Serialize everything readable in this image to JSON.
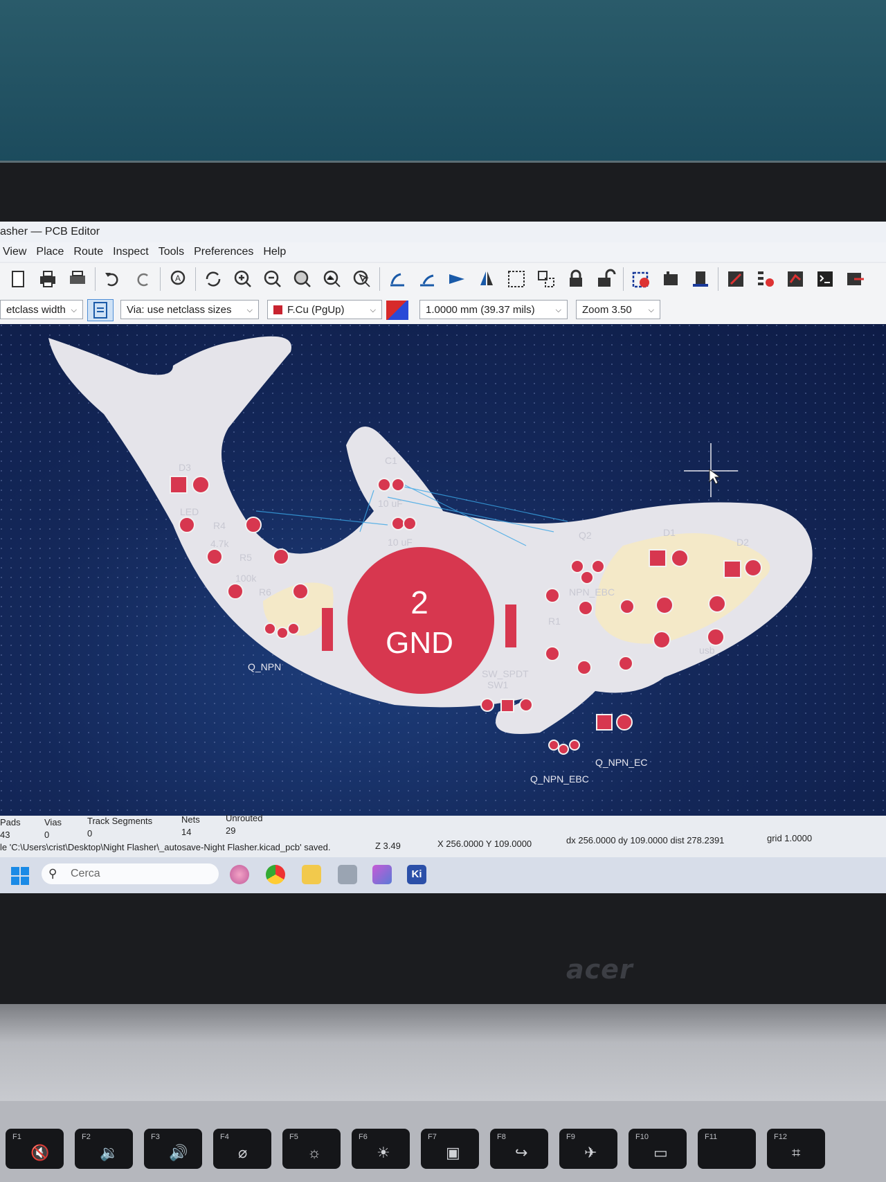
{
  "window": {
    "title": "asher — PCB Editor"
  },
  "menu": [
    "View",
    "Place",
    "Route",
    "Inspect",
    "Tools",
    "Preferences",
    "Help"
  ],
  "toolbar_icons": [
    "new-board-icon",
    "print-icon",
    "plot-icon",
    "undo-icon",
    "redo-icon",
    "find-icon",
    "refresh-icon",
    "zoom-in-icon",
    "zoom-out-icon",
    "zoom-fit-icon",
    "zoom-objects-icon",
    "zoom-selection-icon",
    "rotate-ccw-icon",
    "rotate-cw-icon",
    "flip-icon",
    "mirror-icon",
    "group-icon",
    "ungroup-icon",
    "lock-icon",
    "unlock-icon",
    "drc-icon",
    "footprint-editor-icon",
    "footprint-browser-icon",
    "scripting-icon",
    "netlist-icon",
    "board-setup-icon",
    "console-icon",
    "exit-icon"
  ],
  "selectors": {
    "track_width": "etclass width",
    "via_size": "Via: use netclass sizes",
    "layer": "F.Cu (PgUp)",
    "grid": "1.0000 mm (39.37 mils)",
    "zoom": "Zoom 3.50"
  },
  "canvas": {
    "designators": [
      "D3",
      "LED",
      "R4",
      "4.7k",
      "R5",
      "100k",
      "R6",
      "Q_NPN",
      "C1",
      "10 uF",
      "10 uF",
      "Q2",
      "NPN_EBC",
      "R1",
      "D1",
      "D2",
      "SW_SPDT",
      "SW1",
      "Q_NPN_EC",
      "Q_NPN_EBC",
      "usb"
    ],
    "battery_pad_number": "2",
    "battery_pad_net": "GND"
  },
  "status": {
    "pads_label": "Pads",
    "pads_value": "43",
    "vias_label": "Vias",
    "vias_value": "0",
    "tracks_label": "Track Segments",
    "tracks_value": "0",
    "nets_label": "Nets",
    "nets_value": "14",
    "unrouted_label": "Unrouted",
    "unrouted_value": "29",
    "message": "le 'C:\\Users\\crist\\Desktop\\Night Flasher\\_autosave-Night Flasher.kicad_pcb' saved.",
    "zoom": "Z 3.49",
    "cursor": "X 256.0000  Y 109.0000",
    "delta": "dx 256.0000  dy 109.0000  dist 278.2391",
    "grid": "grid 1.0000"
  },
  "taskbar": {
    "search_placeholder": "Cerca",
    "kicad_label": "Ki"
  },
  "laptop": {
    "brand": "acer"
  },
  "fkeys": [
    {
      "label": "F1",
      "icon": "mute-icon"
    },
    {
      "label": "F2",
      "icon": "volume-down-icon"
    },
    {
      "label": "F3",
      "icon": "volume-up-icon"
    },
    {
      "label": "F4",
      "icon": "mic-mute-icon"
    },
    {
      "label": "F5",
      "icon": "brightness-down-icon"
    },
    {
      "label": "F6",
      "icon": "brightness-up-icon"
    },
    {
      "label": "F7",
      "icon": "display-switch-icon"
    },
    {
      "label": "F8",
      "icon": "input-icon"
    },
    {
      "label": "F9",
      "icon": "airplane-icon"
    },
    {
      "label": "F10",
      "icon": "touchpad-icon"
    },
    {
      "label": "F11",
      "icon": ""
    },
    {
      "label": "F12",
      "icon": "crop-icon"
    }
  ],
  "colors": {
    "pad_red": "#d7374f",
    "silkscreen": "#e8e6ea",
    "board_bg": "#14285a"
  }
}
